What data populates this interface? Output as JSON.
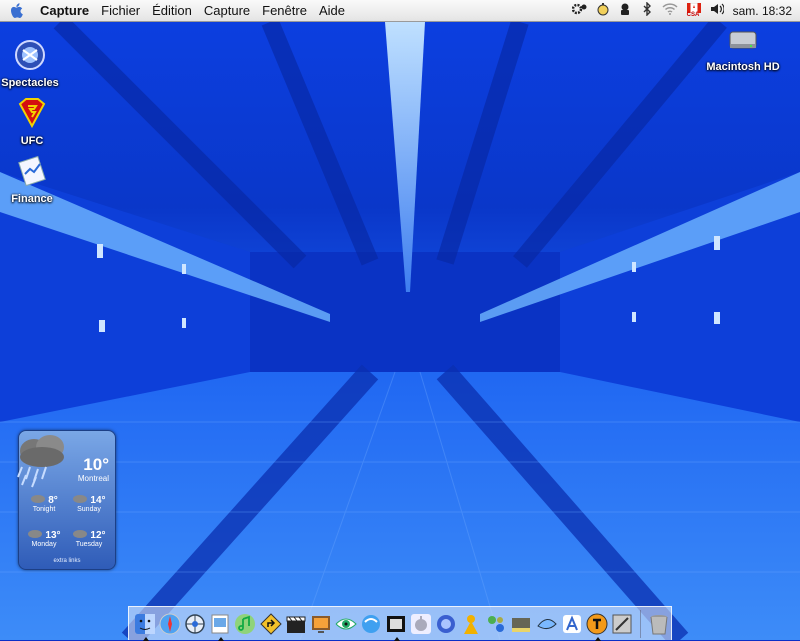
{
  "menubar": {
    "app_name": "Capture",
    "menus": [
      "Fichier",
      "Édition",
      "Capture",
      "Fenêtre",
      "Aide"
    ],
    "clock": "sam. 18:32",
    "input_flag_label": "CSA"
  },
  "desktop_icons": {
    "spectacles": "Spectacles",
    "ufc": "UFC",
    "finance": "Finance",
    "hard_disk": "Macintosh HD"
  },
  "weather": {
    "current_temp": "10°",
    "city": "Montreal",
    "forecast": [
      {
        "temp": "8°",
        "label": "Tonight"
      },
      {
        "temp": "14°",
        "label": "Sunday"
      },
      {
        "temp": "13°",
        "label": "Monday"
      },
      {
        "temp": "12°",
        "label": "Tuesday"
      }
    ],
    "extra_links": "extra links"
  },
  "dock": {
    "apps": [
      "finder-icon",
      "safari-icon",
      "navigator-icon",
      "preview-icon",
      "itunes-music-icon",
      "road-sign-icon",
      "clapper-icon",
      "slideshow-icon",
      "eye-icon",
      "web-globe-icon",
      "clapper-dark-icon",
      "apple-logo-icon",
      "photobooth-icon",
      "messenger-icon",
      "network-icon",
      "instrument-icon",
      "bird-icon",
      "font-icon",
      "omni-icon",
      "tool-icon",
      "trash-icon"
    ]
  }
}
